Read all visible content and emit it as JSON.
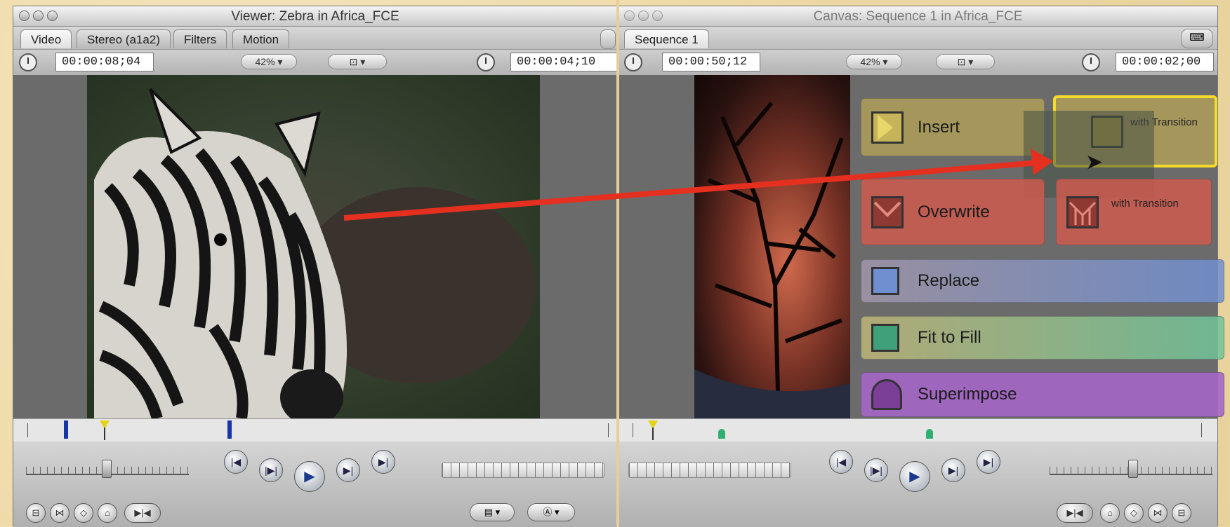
{
  "viewer": {
    "title": "Viewer: Zebra in Africa_FCE",
    "tabs": [
      "Video",
      "Stereo (a1a2)",
      "Filters",
      "Motion"
    ],
    "timecode_left": "00:00:08;04",
    "zoom": "42%",
    "timecode_right": "00:00:04;10"
  },
  "canvas": {
    "title": "Canvas: Sequence 1 in Africa_FCE",
    "tabs": [
      "Sequence 1"
    ],
    "timecode_left": "00:00:50;12",
    "zoom": "42%",
    "timecode_right": "00:00:02;00",
    "overlay": {
      "insert": "Insert",
      "insert_with_transition": "with Transition",
      "overwrite": "Overwrite",
      "overwrite_with_transition": "with Transition",
      "replace": "Replace",
      "fit_to_fill": "Fit to Fill",
      "superimpose": "Superimpose"
    }
  },
  "colors": {
    "insert": "#b8a657",
    "overwrite": "#d45a4c",
    "replace": "#6f8fd0",
    "fit": "#6fc49a",
    "superimpose": "#a566c8",
    "highlight": "#f3dc2a",
    "arrow": "#e53020"
  }
}
